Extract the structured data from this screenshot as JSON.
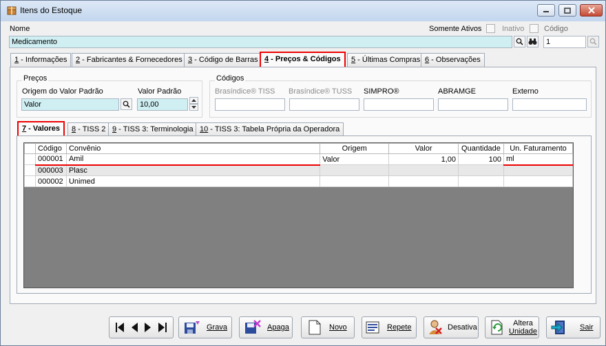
{
  "window": {
    "title": "Itens do Estoque"
  },
  "header": {
    "nome_label": "Nome",
    "nome_value": "Medicamento",
    "somente_ativos_label": "Somente Ativos",
    "inativo_label": "Inativo",
    "codigo_label": "Código",
    "codigo_value": "1"
  },
  "main_tabs": [
    {
      "num": "1",
      "label": " - Informações"
    },
    {
      "num": "2",
      "label": " - Fabricantes & Fornecedores"
    },
    {
      "num": "3",
      "label": " - Código de Barras"
    },
    {
      "num": "4",
      "label": " - Preços & Códigos"
    },
    {
      "num": "5",
      "label": " - Últimas Compras"
    },
    {
      "num": "6",
      "label": " - Observações"
    }
  ],
  "precos": {
    "group_label": "Preços",
    "origem_label": "Origem do Valor Padrão",
    "origem_value": "Valor",
    "valor_label": "Valor Padrão",
    "valor_value": "10,00"
  },
  "codigos": {
    "group_label": "Códigos",
    "fields": [
      "Brasíndice® TISS",
      "Brasíndice® TUSS",
      "SIMPRO®",
      "ABRAMGE",
      "Externo"
    ]
  },
  "sub_tabs": [
    {
      "num": "7",
      "label": " - Valores"
    },
    {
      "num": "8",
      "label": " - TISS 2"
    },
    {
      "num": "9",
      "label": " - TISS 3: Terminologia"
    },
    {
      "num": "10",
      "label": " - TISS 3: Tabela Própria da Operadora"
    }
  ],
  "grid": {
    "columns": [
      "Código",
      "Convênio",
      "Origem",
      "Valor",
      "Quantidade",
      "Un. Faturamento"
    ],
    "rows": [
      [
        "000001",
        "Amil",
        "Valor",
        "1,00",
        "100",
        "ml"
      ],
      [
        "000003",
        "Plasc",
        "",
        "",
        "",
        ""
      ],
      [
        "000002",
        "Unimed",
        "",
        "",
        "",
        ""
      ]
    ]
  },
  "toolbar": {
    "grava": "Grava",
    "apaga": "Apaga",
    "novo": "Novo",
    "repete": "Repete",
    "desativa": "Desativa",
    "altera_unidade_1": "Altera",
    "altera_unidade_2": "Unidade",
    "sair": "Sair"
  },
  "colors": {
    "accent_red": "#e00000",
    "field_cyan": "#cfeff3",
    "grid_bg": "#808080"
  }
}
